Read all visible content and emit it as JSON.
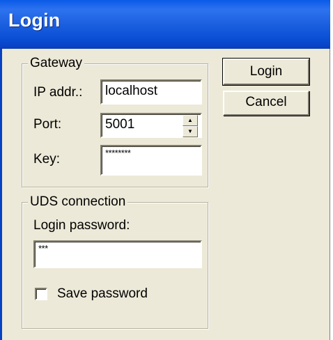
{
  "window": {
    "title": "Login"
  },
  "gateway": {
    "legend": "Gateway",
    "ip_label": "IP addr.:",
    "ip_value": "localhost",
    "port_label": "Port:",
    "port_value": "5001",
    "key_label": "Key:",
    "key_value": "********"
  },
  "uds": {
    "legend": "UDS connection",
    "password_label": "Login password:",
    "password_value": "***",
    "save_label": "Save password",
    "save_checked": false
  },
  "buttons": {
    "login": "Login",
    "cancel": "Cancel"
  },
  "icons": {
    "spin_up": "spin-up-arrow",
    "spin_down": "spin-down-arrow"
  },
  "colors": {
    "titlebar": "#0a4fd5",
    "dialog_bg": "#ece9d8"
  }
}
